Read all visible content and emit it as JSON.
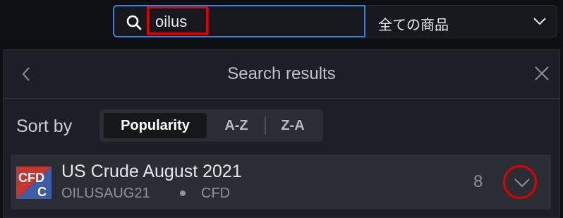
{
  "search": {
    "value": "oilus"
  },
  "category": {
    "selected": "全ての商品"
  },
  "panel": {
    "title": "Search results"
  },
  "sort": {
    "label": "Sort by",
    "options": [
      "Popularity",
      "A-Z",
      "Z-A"
    ],
    "active": "Popularity"
  },
  "results": [
    {
      "logo_top": "CFD",
      "logo_bottom": "C",
      "name": "US Crude August 2021",
      "symbol": "OILUSAUG21",
      "type": "CFD",
      "count": "8"
    }
  ],
  "colors": {
    "accent_border": "#3f7fe0",
    "annotation_red": "#e00000",
    "panel_bg": "#1c1f25",
    "row_bg": "#2a2d33"
  }
}
